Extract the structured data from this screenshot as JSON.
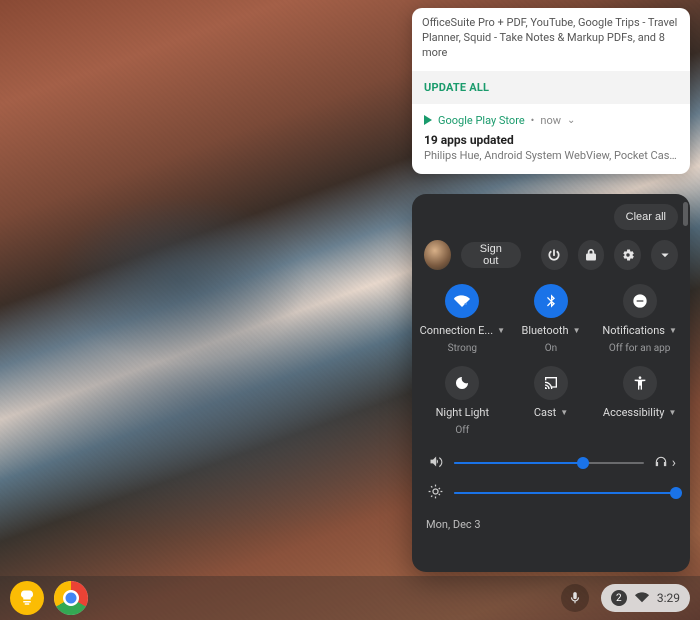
{
  "notification": {
    "summary": "OfficeSuite Pro + PDF, YouTube, Google Trips - Travel Planner, Squid - Take Notes & Markup PDFs, and 8 more",
    "update_all": "UPDATE ALL",
    "source": "Google Play Store",
    "separator": "•",
    "when": "now",
    "title": "19 apps updated",
    "subtitle": "Philips Hue, Android System WebView, Pocket Casts, Co..."
  },
  "panel": {
    "clear_all": "Clear all",
    "sign_out": "Sign out",
    "date": "Mon, Dec 3",
    "tiles": [
      {
        "label": "Connection E...",
        "sub": "Strong",
        "active": true,
        "has_caret": true
      },
      {
        "label": "Bluetooth",
        "sub": "On",
        "active": true,
        "has_caret": true
      },
      {
        "label": "Notifications",
        "sub": "Off for an app",
        "active": false,
        "has_caret": true
      },
      {
        "label": "Night Light",
        "sub": "Off",
        "active": false,
        "has_caret": false
      },
      {
        "label": "Cast",
        "sub": "",
        "active": false,
        "has_caret": true
      },
      {
        "label": "Accessibility",
        "sub": "",
        "active": false,
        "has_caret": true
      }
    ],
    "volume_percent": 68,
    "brightness_percent": 100
  },
  "shelf": {
    "notif_count": "2",
    "clock": "3:29"
  }
}
